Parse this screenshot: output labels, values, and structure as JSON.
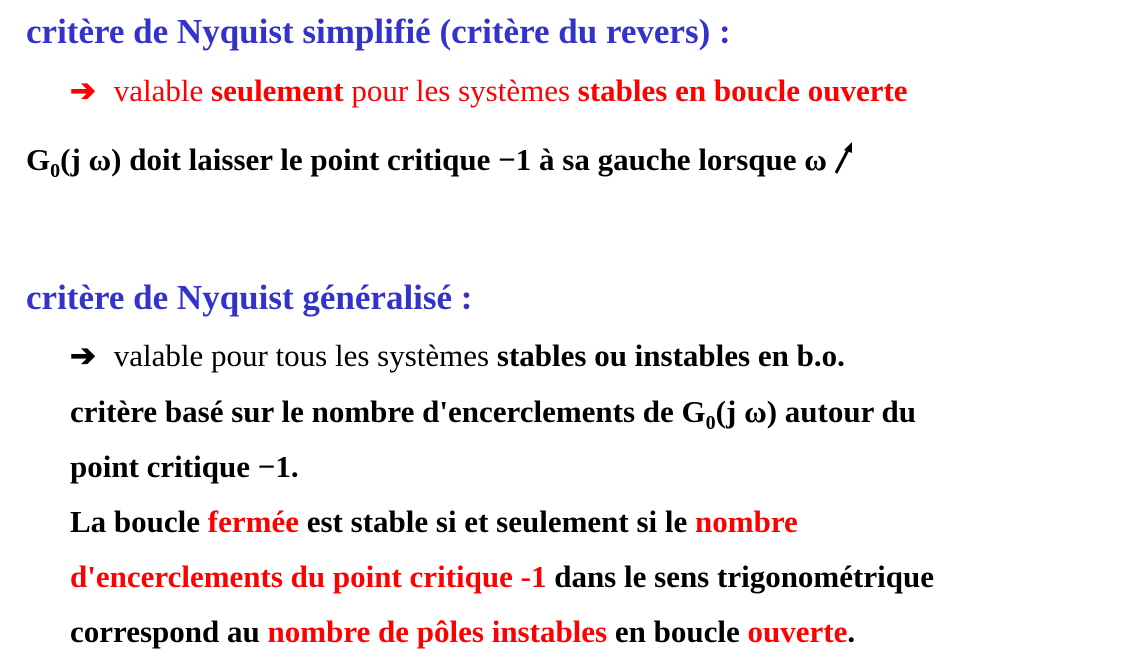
{
  "section1": {
    "heading": "critère de Nyquist simplifié (critère du revers) :",
    "arrow": "➔",
    "line1": [
      {
        "text": " valable ",
        "style": "red"
      },
      {
        "text": "seulement",
        "style": "red-bold"
      },
      {
        "text": " pour les systèmes ",
        "style": "red"
      },
      {
        "text": "stables en boucle ouverte",
        "style": "red-bold"
      }
    ],
    "line2": {
      "g": "G",
      "sub": "0",
      "rest": "(j ω) doit laisser le point critique −1 à sa gauche lorsque ω",
      "arrow_icon": "arrow-up-right-icon"
    }
  },
  "section2": {
    "heading": "critère de Nyquist généralisé :",
    "arrow": "➔",
    "line1": [
      {
        "text": " valable pour tous les systèmes ",
        "style": "normal"
      },
      {
        "text": "stables ou instables en b.o.",
        "style": "bold"
      }
    ],
    "line2": {
      "pre": "critère basé sur le nombre d'encerclements de ",
      "g": "G",
      "sub": "0",
      "post": "(j ω) autour du"
    },
    "line3": "point critique −1.",
    "line4": [
      {
        "text": "La boucle ",
        "style": "bold"
      },
      {
        "text": "fermée",
        "style": "red-bold"
      },
      {
        "text": " est stable si et seulement si le ",
        "style": "bold"
      },
      {
        "text": "nombre",
        "style": "red-bold"
      }
    ],
    "line5": [
      {
        "text": "d'encerclements du point critique -1",
        "style": "red-bold"
      },
      {
        "text": " dans le sens trigonométrique",
        "style": "bold"
      }
    ],
    "line6": [
      {
        "text": "correspond au ",
        "style": "bold"
      },
      {
        "text": "nombre de pôles instables",
        "style": "red-bold"
      },
      {
        "text": " en boucle ",
        "style": "bold"
      },
      {
        "text": "ouverte",
        "style": "red-bold"
      },
      {
        "text": ".",
        "style": "bold"
      }
    ]
  },
  "colors": {
    "heading": "#3333cc",
    "emphasis": "#ff0000",
    "text": "#000000"
  }
}
